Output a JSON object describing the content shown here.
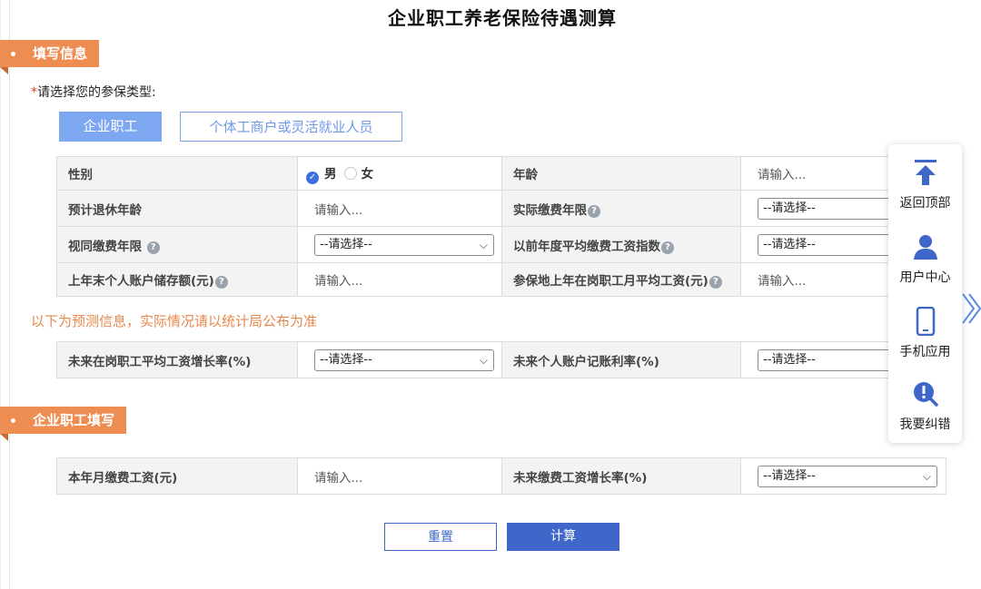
{
  "title": "企业职工养老保险待遇测算",
  "section1": {
    "label": "填写信息"
  },
  "insurance_type": {
    "required_mark": "*",
    "label": "请选择您的参保类型:",
    "options": [
      "企业职工",
      "个体工商户或灵活就业人员"
    ],
    "selected": "企业职工"
  },
  "table1": {
    "gender_label": "性别",
    "gender_male": "男",
    "gender_female": "女",
    "age_label": "年龄",
    "age_placeholder": "请输入...",
    "retire_age_label": "预计退休年龄",
    "retire_age_placeholder": "请输入...",
    "actual_years_label": "实际缴费年限",
    "actual_years_value": "--请选择--",
    "deemed_years_label": "视同缴费年限",
    "deemed_years_value": "--请选择--",
    "avg_index_label": "以前年度平均缴费工资指数",
    "avg_index_value": "--请选择--",
    "account_balance_label": "上年末个人账户储存额(元)",
    "account_balance_placeholder": "请输入...",
    "local_avg_wage_label": "参保地上年在岗职工月平均工资(元)",
    "local_avg_wage_placeholder": "请输入..."
  },
  "notice": "以下为预测信息，实际情况请以统计局公布为准",
  "table2": {
    "wage_growth_label": "未来在岗职工平均工资增长率(%)",
    "wage_growth_value": "--请选择--",
    "account_rate_label": "未来个人账户记账利率(%)",
    "account_rate_value": "--请选择--"
  },
  "section2": {
    "label": "企业职工填写"
  },
  "table3": {
    "monthly_wage_label": "本年月缴费工资(元)",
    "monthly_wage_placeholder": "请输入...",
    "contrib_growth_label": "未来缴费工资增长率(%)",
    "contrib_growth_value": "--请选择--"
  },
  "buttons": {
    "reset": "重置",
    "calculate": "计算"
  },
  "floatbar": {
    "items": [
      {
        "label": "返回顶部",
        "icon": "arrow-up-to-top-icon"
      },
      {
        "label": "用户中心",
        "icon": "user-icon"
      },
      {
        "label": "手机应用",
        "icon": "mobile-phone-icon"
      },
      {
        "label": "我要纠错",
        "icon": "alert-magnifier-icon"
      }
    ]
  },
  "colors": {
    "accent": "#3f67c9",
    "orange": "#ee8d52",
    "light_blue": "#7ea7f2"
  }
}
